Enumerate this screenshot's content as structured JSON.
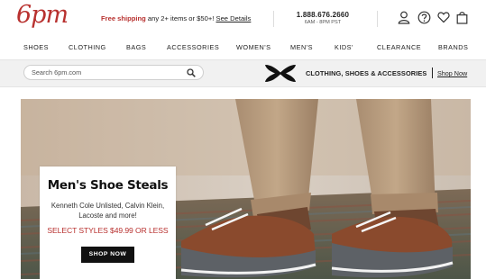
{
  "header": {
    "logo_text": "6pm",
    "promo": {
      "highlight": "Free shipping",
      "rest": "any 2+ items or $50+!",
      "link": "See Details"
    },
    "phone": {
      "number": "1.888.676.2660",
      "hours": "6AM - 8PM PST"
    },
    "icons": [
      "account-icon",
      "help-icon",
      "favorites-icon",
      "cart-icon"
    ]
  },
  "nav": {
    "items": [
      "SHOES",
      "CLOTHING",
      "BAGS",
      "ACCESSORIES",
      "WOMEN'S",
      "MEN'S",
      "KIDS'",
      "CLEARANCE",
      "BRANDS"
    ]
  },
  "search": {
    "placeholder": "Search 6pm.com"
  },
  "brand_banner": {
    "text": "CLOTHING, SHOES & ACCESSORIES",
    "link": "Shop Now"
  },
  "hero": {
    "title": "Men's Shoe Steals",
    "brands": "Kenneth Cole Unlisted, Calvin Klein, Lacoste and more!",
    "price": "SELECT STYLES $49.99 OR LESS",
    "button": "SHOP NOW"
  },
  "colors": {
    "brand_red": "#b8312f",
    "black": "#111111"
  }
}
